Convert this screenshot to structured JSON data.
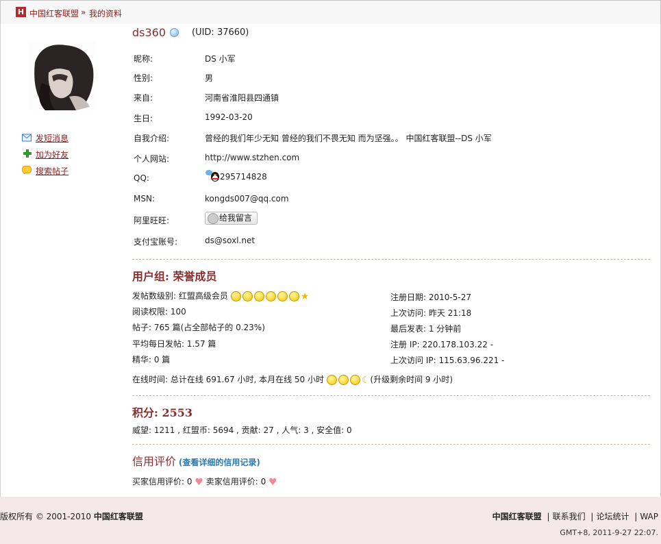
{
  "breadcrumb": {
    "logo": "H",
    "site": "中国红客联盟",
    "separator": "»",
    "current": "我的资料"
  },
  "profile": {
    "username": "ds360",
    "uid": "(UID: 37660)",
    "fields": [
      {
        "label": "昵称:",
        "value": "DS 小军"
      },
      {
        "label": "性别:",
        "value": "男"
      },
      {
        "label": "来自:",
        "value": "河南省淮阳县四通镇"
      },
      {
        "label": "生日:",
        "value": "1992-03-20"
      },
      {
        "label": "自我介绍:",
        "value": "曾经的我们年少无知 曾经的我们不畏无知 而为坚强。。 中国红客联盟--DS 小军"
      },
      {
        "label": "个人网站:",
        "value": "http://www.stzhen.com"
      },
      {
        "label": "QQ:",
        "value": "295714828"
      },
      {
        "label": "MSN:",
        "value": "kongds007@qq.com"
      },
      {
        "label": "阿里旺旺:",
        "value": "给我留言"
      },
      {
        "label": "支付宝账号:",
        "value": "ds@soxl.net"
      }
    ]
  },
  "sidebar": {
    "links": [
      {
        "label": "发短消息",
        "icon": "mail-icon"
      },
      {
        "label": "加为好友",
        "icon": "add-friend-icon"
      },
      {
        "label": "搜索帖子",
        "icon": "search-posts-icon"
      }
    ]
  },
  "group": {
    "title": "用户组: 荣誉成员",
    "left": [
      "发帖数级别: 红盟高级会员",
      "阅读权限: 100",
      "帖子: 765 篇(占全部帖子的 0.23%)",
      "平均每日发帖: 1.57 篇",
      "精华: 0 篇"
    ],
    "right": [
      "注册日期: 2010-5-27",
      "上次访问: 昨天 21:18",
      "最后发表: 1 分钟前",
      "注册 IP: 220.178.103.22 -",
      "上次访问 IP: 115.63.96.221 -"
    ],
    "online_prefix": "在线时间: 总计在线 691.67 小时, 本月在线 50 小时",
    "online_suffix": "(升级剩余时间 9 小时)"
  },
  "points": {
    "title": "积分: 2553",
    "detail": "威望: 1211 , 红盟币: 5694 , 贡献: 27 , 人气: 3 , 安全值: 0"
  },
  "credit": {
    "title": "信用评价",
    "link": "(查看详细的信用记录)",
    "buyer": "买家信用评价: 0",
    "seller": "卖家信用评价: 0"
  },
  "footer": {
    "copyright": "版权所有 © 2001-2010",
    "site": "中国红客联盟",
    "links": [
      "中国红客联盟",
      "联系我们",
      "论坛统计",
      "WAP"
    ],
    "time": "GMT+8, 2011-9-27 22:07."
  },
  "colors": {
    "accent": "#8b2d2d",
    "link": "#2a7bb0",
    "footer_bg": "#f4e8ea"
  }
}
